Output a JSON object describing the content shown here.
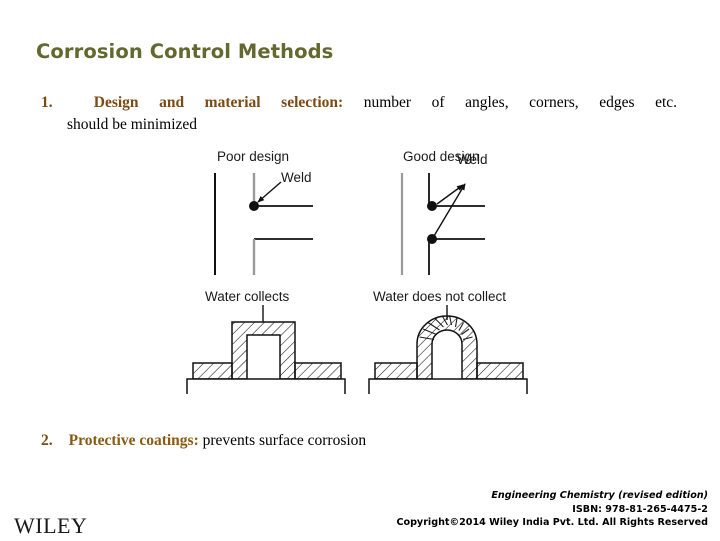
{
  "slide": {
    "title": "Corrosion Control Methods",
    "title_color": "#63682f",
    "accent_color": "#7c4a14",
    "background": "#ffffff"
  },
  "bullets": [
    {
      "number": "1.",
      "lead": "Design and material selection:",
      "body_line1": "number  of  angles,  corners,  edges  etc.",
      "body_line2": "should be minimized"
    },
    {
      "number": "2.",
      "lead": "Protective coatings:",
      "body": "prevents surface corrosion"
    }
  ],
  "figure": {
    "panels": [
      {
        "id": "poor-design",
        "label": "Poor design",
        "weld_label": "Weld",
        "welds": 1
      },
      {
        "id": "good-design",
        "label": "Good design",
        "weld_label": "Weld",
        "welds": 2
      },
      {
        "id": "water-collects",
        "label": "Water collects"
      },
      {
        "id": "water-does-not-collect",
        "label": "Water does not collect"
      }
    ]
  },
  "footer": {
    "logo": "WILEY",
    "book_title": "Engineering Chemistry (revised edition)",
    "isbn": "ISBN: 978-81-265-4475-2",
    "copyright": "Copyright©2014 Wiley India Pvt. Ltd. All Rights Reserved"
  }
}
